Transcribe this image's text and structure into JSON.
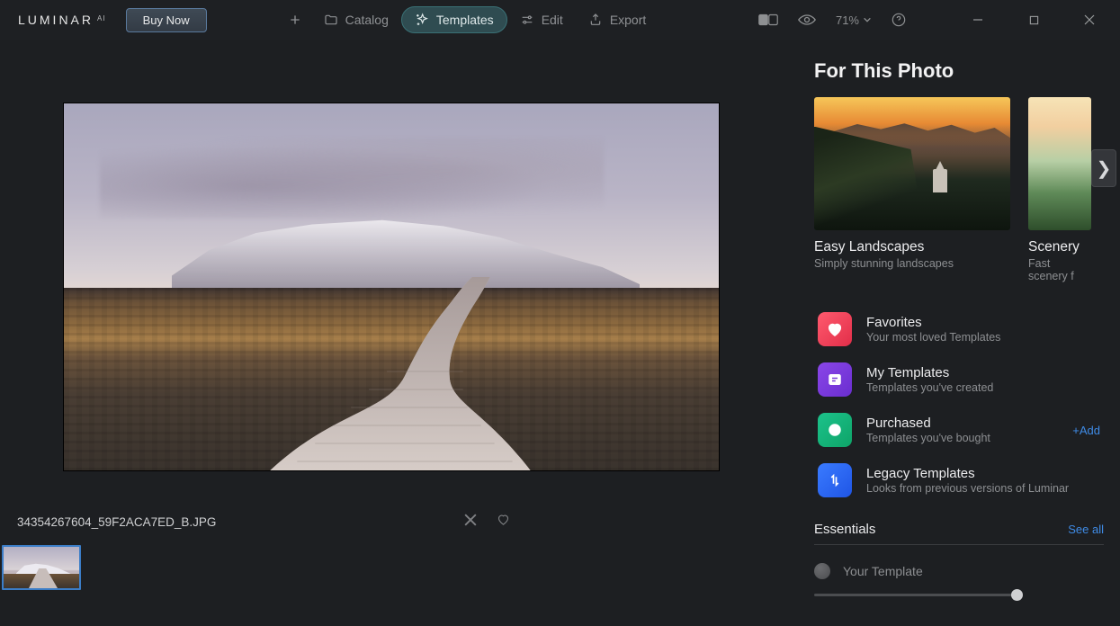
{
  "app": {
    "name": "LUMINAR",
    "suffix": "AI"
  },
  "topbar": {
    "buy_now": "Buy Now",
    "catalog": "Catalog",
    "templates": "Templates",
    "edit": "Edit",
    "export": "Export",
    "zoom": "71%"
  },
  "panel": {
    "title": "For This Photo",
    "collections": [
      {
        "title": "Easy Landscapes",
        "subtitle": "Simply stunning landscapes"
      },
      {
        "title": "Scenery",
        "subtitle": "Fast scenery f"
      }
    ],
    "categories": [
      {
        "key": "favorites",
        "title": "Favorites",
        "subtitle": "Your most loved Templates"
      },
      {
        "key": "my",
        "title": "My Templates",
        "subtitle": "Templates you've created"
      },
      {
        "key": "purchased",
        "title": "Purchased",
        "subtitle": "Templates you've bought",
        "action": "+Add"
      },
      {
        "key": "legacy",
        "title": "Legacy Templates",
        "subtitle": "Looks from previous versions of Luminar"
      }
    ],
    "essentials": {
      "title": "Essentials",
      "see_all": "See all"
    },
    "your_template": "Your Template"
  },
  "file": {
    "name": "34354267604_59F2ACA7ED_B.JPG"
  }
}
